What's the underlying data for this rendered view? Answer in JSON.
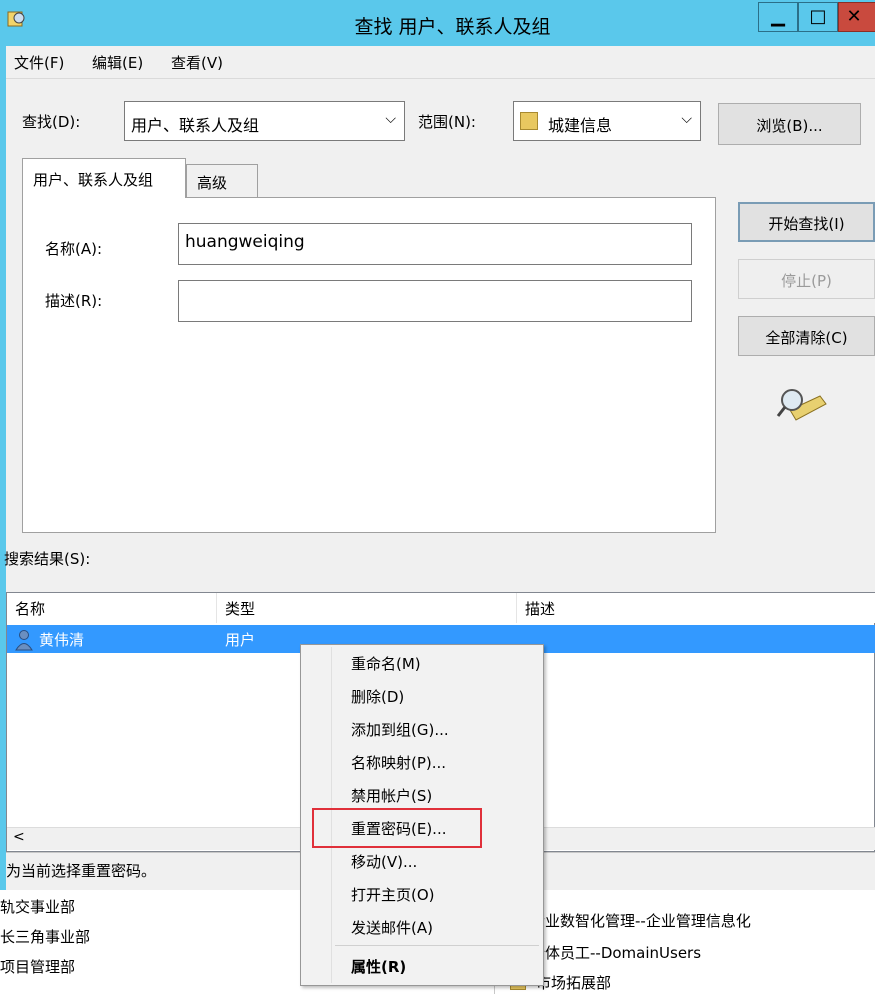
{
  "window": {
    "title": "查找 用户、联系人及组",
    "minimize_glyph": "▁",
    "maximize_glyph": "□",
    "close_glyph": "✕"
  },
  "menubar": {
    "file": "文件(F)",
    "edit": "编辑(E)",
    "view": "查看(V)"
  },
  "search": {
    "find_label": "查找(D):",
    "find_value": "用户、联系人及组",
    "scope_label": "范围(N):",
    "scope_value": "城建信息",
    "browse_button": "浏览(B)..."
  },
  "tabs": {
    "active": "用户、联系人及组",
    "advanced": "高级"
  },
  "form": {
    "name_label": "名称(A):",
    "name_value": "huangweiqing",
    "desc_label": "描述(R):",
    "desc_value": ""
  },
  "buttons": {
    "find_now": "开始查找(I)",
    "stop": "停止(P)",
    "clear_all": "全部清除(C)"
  },
  "results": {
    "label": "搜索结果(S):",
    "columns": [
      "名称",
      "类型",
      "描述"
    ],
    "rows": [
      {
        "name": "黄伟清",
        "type": "用户",
        "description": ""
      }
    ],
    "scroll_left": "<"
  },
  "status": "为当前选择重置密码。",
  "background_left": [
    "轨交事业部",
    "长三角事业部",
    "项目管理部"
  ],
  "background_right": [
    "企业数智化管理--企业管理信息化",
    "全体员工--DomainUsers",
    "市场拓展部"
  ],
  "context_menu": {
    "items": [
      "重命名(M)",
      "删除(D)",
      "添加到组(G)...",
      "名称映射(P)...",
      "禁用帐户(S)",
      "重置密码(E)...",
      "移动(V)...",
      "打开主页(O)",
      "发送邮件(A)"
    ],
    "properties": "属性(R)"
  },
  "colors": {
    "titlebar": "#5ac8eb",
    "selection": "#3399ff",
    "highlight": "#e0303a"
  }
}
